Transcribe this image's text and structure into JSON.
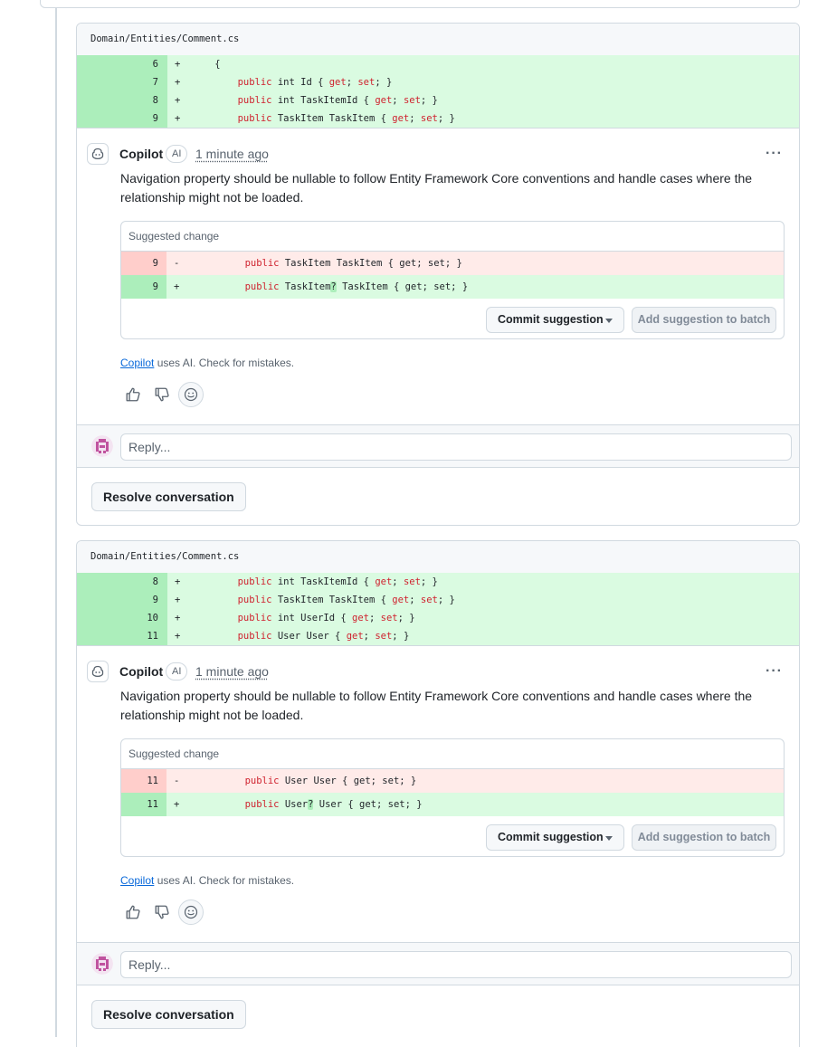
{
  "threads": [
    {
      "file_path": "Domain/Entities/Comment.cs",
      "diff_lines": [
        {
          "num": "6",
          "sign": "+",
          "indent": "    ",
          "kw": "",
          "rest": "{",
          "kw2": "",
          "mid": "",
          "kw3": "",
          "end": ""
        },
        {
          "num": "7",
          "sign": "+",
          "indent": "        ",
          "kw": "public",
          "rest": " int Id { ",
          "kw2": "get",
          "mid": "; ",
          "kw3": "set",
          "end": "; }"
        },
        {
          "num": "8",
          "sign": "+",
          "indent": "        ",
          "kw": "public",
          "rest": " int TaskItemId { ",
          "kw2": "get",
          "mid": "; ",
          "kw3": "set",
          "end": "; }"
        },
        {
          "num": "9",
          "sign": "+",
          "indent": "        ",
          "kw": "public",
          "rest": " TaskItem TaskItem { ",
          "kw2": "get",
          "mid": "; ",
          "kw3": "set",
          "end": "; }"
        }
      ],
      "comment": {
        "author": "Copilot",
        "badge": "AI",
        "timestamp": "1 minute ago",
        "more": "···",
        "body": "Navigation property should be nullable to follow Entity Framework Core conventions and handle cases where the relationship might not be loaded.",
        "suggestion": {
          "header": "Suggested change",
          "removed": {
            "num": "9",
            "sign": "-",
            "kw": "public",
            "before": " TaskItem",
            "hl": "",
            "after": " TaskItem { get; set; }"
          },
          "added": {
            "num": "9",
            "sign": "+",
            "kw": "public",
            "before": " TaskItem",
            "hl": "?",
            "after": " TaskItem { get; set; }"
          },
          "commit_label": "Commit suggestion",
          "batch_label": "Add suggestion to batch"
        },
        "disclaimer_link": "Copilot",
        "disclaimer_text": " uses AI. Check for mistakes."
      },
      "reply_placeholder": "Reply...",
      "resolve_label": "Resolve conversation"
    },
    {
      "file_path": "Domain/Entities/Comment.cs",
      "diff_lines": [
        {
          "num": "8",
          "sign": "+",
          "indent": "        ",
          "kw": "public",
          "rest": " int TaskItemId { ",
          "kw2": "get",
          "mid": "; ",
          "kw3": "set",
          "end": "; }"
        },
        {
          "num": "9",
          "sign": "+",
          "indent": "        ",
          "kw": "public",
          "rest": " TaskItem TaskItem { ",
          "kw2": "get",
          "mid": "; ",
          "kw3": "set",
          "end": "; }"
        },
        {
          "num": "10",
          "sign": "+",
          "indent": "        ",
          "kw": "public",
          "rest": " int UserId { ",
          "kw2": "get",
          "mid": "; ",
          "kw3": "set",
          "end": "; }"
        },
        {
          "num": "11",
          "sign": "+",
          "indent": "        ",
          "kw": "public",
          "rest": " User User { ",
          "kw2": "get",
          "mid": "; ",
          "kw3": "set",
          "end": "; }"
        }
      ],
      "comment": {
        "author": "Copilot",
        "badge": "AI",
        "timestamp": "1 minute ago",
        "more": "···",
        "body": "Navigation property should be nullable to follow Entity Framework Core conventions and handle cases where the relationship might not be loaded.",
        "suggestion": {
          "header": "Suggested change",
          "removed": {
            "num": "11",
            "sign": "-",
            "kw": "public",
            "before": " User",
            "hl": "",
            "after": " User { get; set; }"
          },
          "added": {
            "num": "11",
            "sign": "+",
            "kw": "public",
            "before": " User",
            "hl": "?",
            "after": " User { get; set; }"
          },
          "commit_label": "Commit suggestion",
          "batch_label": "Add suggestion to batch"
        },
        "disclaimer_link": "Copilot",
        "disclaimer_text": " uses AI. Check for mistakes."
      },
      "reply_placeholder": "Reply...",
      "resolve_label": "Resolve conversation"
    }
  ],
  "colors": {
    "added_bg": "#dafbe1",
    "added_num_bg": "#aceebb",
    "removed_bg": "#ffebe9",
    "removed_num_bg": "#ffcecb",
    "keyword": "#cf222e",
    "link": "#0969da"
  },
  "icons": [
    "copilot-icon",
    "thumbs-up-icon",
    "thumbs-down-icon",
    "smiley-icon",
    "kebab-icon",
    "caret-down-icon",
    "user-avatar-icon"
  ]
}
